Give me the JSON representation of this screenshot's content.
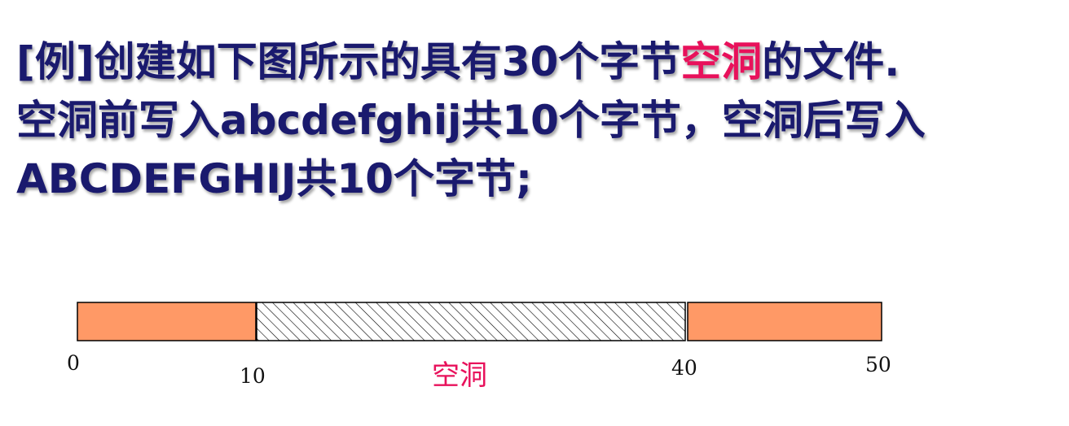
{
  "heading": {
    "line1": {
      "a": "[例]创建如下图所示的具有30个字节",
      "b": "空洞",
      "c": "的文件."
    },
    "line2": "空洞前写入abcdefghij共10个字节，空洞后写入",
    "line3": "ABCDEFGHIJ共10个字节;"
  },
  "diagram": {
    "hole_label": "空洞",
    "ticks": [
      "0",
      "10",
      "40",
      "50"
    ],
    "segments": [
      {
        "kind": "data",
        "from": 0,
        "to": 10
      },
      {
        "kind": "hole",
        "from": 10,
        "to": 40
      },
      {
        "kind": "data",
        "from": 40,
        "to": 50
      }
    ],
    "colors": {
      "data_fill": "#ff9966",
      "hole_hatch": "#000000",
      "text": "#1a1a6e",
      "highlight": "#e8115b"
    }
  }
}
